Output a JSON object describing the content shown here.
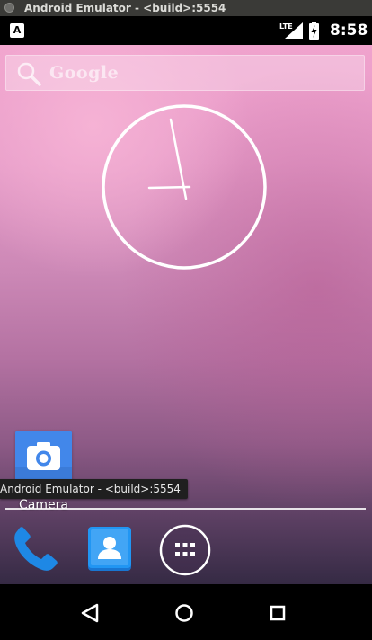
{
  "window": {
    "title": "Android Emulator - <build>:5554"
  },
  "status_bar": {
    "notification_icon_letter": "A",
    "network_label": "LTE",
    "time": "8:58",
    "icons": [
      "signal-icon",
      "battery-charging-icon"
    ]
  },
  "home": {
    "search": {
      "placeholder": "Google",
      "icon": "magnifier-icon"
    },
    "analog_clock": {
      "hour": 8,
      "minute": 58,
      "color": "#ffffff"
    },
    "apps": [
      {
        "label": "Camera",
        "icon": "camera-icon",
        "color": "#3f87e6"
      }
    ],
    "tooltip": "Android Emulator - <build>:5554",
    "dock": [
      {
        "name": "Phone",
        "icon": "phone-icon",
        "color": "#1e88e5"
      },
      {
        "name": "Contacts",
        "icon": "contacts-icon",
        "color": "#2196f3"
      },
      {
        "name": "All apps",
        "icon": "app-drawer-icon"
      }
    ]
  },
  "nav_bar": {
    "buttons": [
      "back-icon",
      "home-icon",
      "recents-icon"
    ]
  },
  "colors": {
    "wallpaper_top": "#f0a2cd",
    "wallpaper_bottom": "#352a44",
    "title_bar": "#3a3a37"
  }
}
